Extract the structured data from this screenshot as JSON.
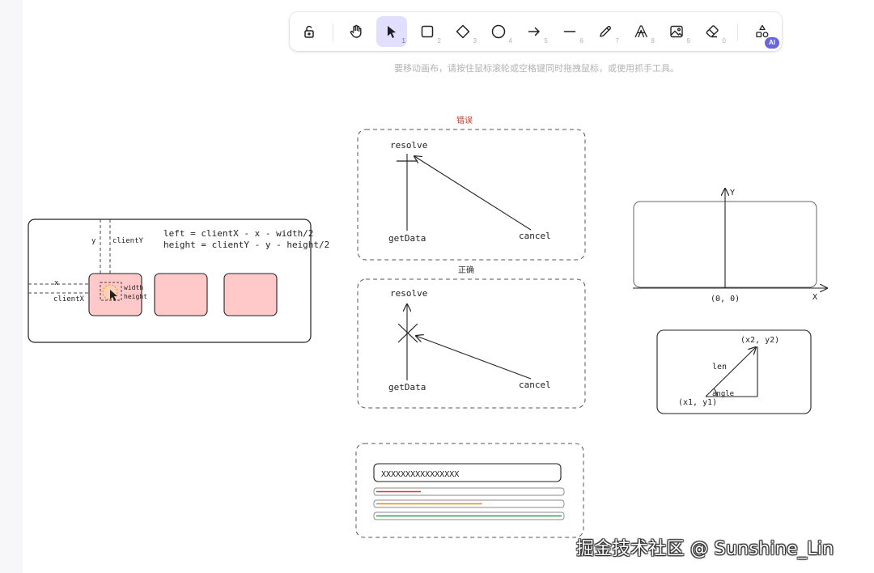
{
  "toolbar": {
    "tools": [
      {
        "name": "lock-icon",
        "key": ""
      },
      {
        "name": "hand-icon",
        "key": ""
      },
      {
        "name": "selection-icon",
        "key": "1"
      },
      {
        "name": "rectangle-icon",
        "key": "2"
      },
      {
        "name": "diamond-icon",
        "key": "3"
      },
      {
        "name": "ellipse-icon",
        "key": "4"
      },
      {
        "name": "arrow-icon",
        "key": "5"
      },
      {
        "name": "line-icon",
        "key": "6"
      },
      {
        "name": "pencil-icon",
        "key": "7"
      },
      {
        "name": "text-icon",
        "key": "8"
      },
      {
        "name": "image-icon",
        "key": "9"
      },
      {
        "name": "eraser-icon",
        "key": "0"
      },
      {
        "name": "more-shapes-icon",
        "key": ""
      }
    ],
    "active_tool": "selection-icon",
    "ai_badge": "AI",
    "accent": "#6965db"
  },
  "hint": "要移动画布，请按住鼠标滚轮或空格键同时拖拽鼠标，或使用抓手工具。",
  "canvas": {
    "left_panel": {
      "formula1": "left = clientX - x - width/2",
      "formula2": "height = clientY - y - height/2",
      "label_y": "y",
      "label_clienty": "clientY",
      "label_x": "x",
      "label_clientx": "clientX",
      "label_width": "width",
      "label_height": "height",
      "card_color": "#ffc9c9"
    },
    "wrong": {
      "title": "错误",
      "resolve": "resolve",
      "getdata": "getData",
      "cancel": "cancel"
    },
    "right": {
      "title": "正确",
      "resolve": "resolve",
      "getdata": "getData",
      "cancel": "cancel"
    },
    "axis": {
      "y": "Y",
      "x": "X",
      "origin": "(0, 0)"
    },
    "triangle": {
      "p2": "(x2, y2)",
      "p1": "(x1, y1)",
      "len": "len",
      "angle": "angle"
    },
    "progress": {
      "input_value": "XXXXXXXXXXXXXXXX",
      "bars": [
        {
          "color": "#e03131",
          "fraction": 0.24
        },
        {
          "color": "#f08c00",
          "fraction": 0.57
        },
        {
          "color": "#2f9e44",
          "fraction": 1.0
        }
      ]
    }
  },
  "watermark": "掘金技术社区 @ Sunshine_Lin"
}
